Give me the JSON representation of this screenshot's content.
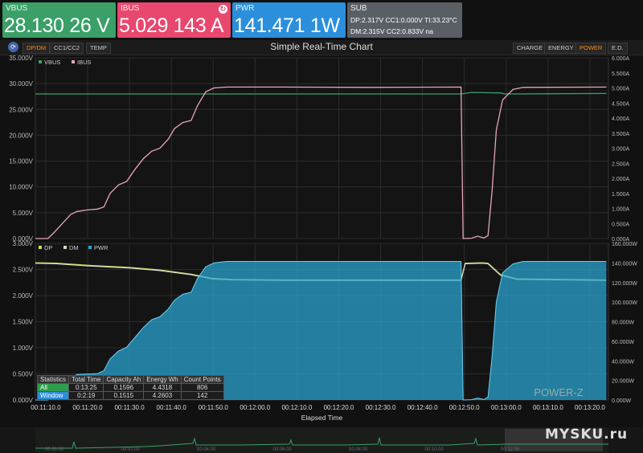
{
  "cards": {
    "vbus": {
      "label": "VBUS",
      "value": "28.130 26 V",
      "color": "#3aa068"
    },
    "ibus": {
      "label": "IBUS",
      "value": "5.029 143 A",
      "color": "#e8476e"
    },
    "pwr": {
      "label": "PWR",
      "value": "141.471 1W",
      "color": "#2b8fdb"
    },
    "sub": {
      "label": "SUB",
      "line1": "DP:2.317V   CC1:0.000V   TI:33.23°C",
      "line2": "DM:2.315V   CC2:0.833V  na"
    }
  },
  "toolbar": {
    "left_tabs": [
      "DP/DM",
      "CC1/CC2",
      "TEMP"
    ],
    "right_tabs": [
      "CHARGE",
      "ENERGY",
      "POWER",
      "E.D."
    ],
    "active_left": "DP/DM",
    "active_right": "POWER",
    "title": "Simple Real-Time Chart",
    "icon": "power-z-logo-icon"
  },
  "chart_data": [
    {
      "type": "line",
      "x_ticks": [
        "00:11:10.0",
        "00:11:20.0",
        "00:11:30.0",
        "00:11:40.0",
        "00:11:50.0",
        "00:12:00.0",
        "00:12:10.0",
        "00:12:20.0",
        "00:12:30.0",
        "00:12:40.0",
        "00:12:50.0",
        "00:13:00.0",
        "00:13:10.0",
        "00:13:20.0"
      ],
      "xlabel": "Elapsed Time",
      "ylim_left": [
        0,
        35
      ],
      "y_ticks_left": [
        "0.000V",
        "5.000V",
        "10.000V",
        "15.000V",
        "20.000V",
        "25.000V",
        "30.000V",
        "35.000V"
      ],
      "ylim_right": [
        0,
        6
      ],
      "y_ticks_right": [
        "0.000A",
        "0.500A",
        "1.000A",
        "1.500A",
        "2.000A",
        "2.500A",
        "3.000A",
        "3.500A",
        "4.000A",
        "4.500A",
        "5.000A",
        "5.500A",
        "6.000A"
      ],
      "legend": [
        "VBUS",
        "IBUS"
      ],
      "series": [
        {
          "name": "VBUS",
          "axis": "left",
          "color": "#3aa068",
          "points": [
            [
              0,
              28
            ],
            [
              100,
              28
            ],
            [
              205,
              28
            ],
            [
              210,
              28.3
            ],
            [
              224,
              28.2
            ],
            [
              226,
              28
            ],
            [
              250,
              28.05
            ],
            [
              275,
              28.1
            ]
          ]
        },
        {
          "name": "IBUS",
          "axis": "right",
          "color": "#e8a6b6",
          "points": [
            [
              0,
              0
            ],
            [
              6,
              0
            ],
            [
              9,
              0.2
            ],
            [
              13,
              0.5
            ],
            [
              17,
              0.8
            ],
            [
              20,
              0.9
            ],
            [
              25,
              0.95
            ],
            [
              30,
              0.98
            ],
            [
              33,
              1.05
            ],
            [
              36,
              1.5
            ],
            [
              40,
              1.78
            ],
            [
              44,
              1.9
            ],
            [
              48,
              2.3
            ],
            [
              52,
              2.65
            ],
            [
              56,
              2.9
            ],
            [
              60,
              3.0
            ],
            [
              64,
              3.3
            ],
            [
              67,
              3.65
            ],
            [
              71,
              3.85
            ],
            [
              75,
              3.92
            ],
            [
              78,
              4.4
            ],
            [
              82,
              4.87
            ],
            [
              86,
              5.0
            ],
            [
              92,
              5.03
            ],
            [
              120,
              5.03
            ],
            [
              160,
              5.02
            ],
            [
              205,
              5.03
            ],
            [
              206,
              0.0
            ],
            [
              210,
              0.01
            ],
            [
              213,
              0.08
            ],
            [
              216,
              0.02
            ],
            [
              218,
              0.1
            ],
            [
              220,
              1.6
            ],
            [
              222,
              3.6
            ],
            [
              225,
              4.6
            ],
            [
              230,
              4.95
            ],
            [
              235,
              5.02
            ],
            [
              275,
              5.03
            ]
          ]
        }
      ]
    },
    {
      "type": "area",
      "x_ticks": [
        "00:11:10.0",
        "00:11:20.0",
        "00:11:30.0",
        "00:11:40.0",
        "00:11:50.0",
        "00:12:00.0",
        "00:12:10.0",
        "00:12:20.0",
        "00:12:30.0",
        "00:12:40.0",
        "00:12:50.0",
        "00:13:00.0",
        "00:13:10.0",
        "00:13:20.0"
      ],
      "xlabel": "Elapsed Time",
      "ylim_left": [
        0,
        3
      ],
      "y_ticks_left": [
        "0.000V",
        "0.500V",
        "1.000V",
        "1.500V",
        "2.000V",
        "2.500V",
        "3.000V"
      ],
      "ylim_right": [
        0,
        160
      ],
      "y_ticks_right": [
        "0.000W",
        "20.000W",
        "40.000W",
        "60.000W",
        "80.000W",
        "100.000W",
        "120.000W",
        "140.000W",
        "160.000W"
      ],
      "legend": [
        "DP",
        "DM",
        "PWR"
      ],
      "series": [
        {
          "name": "DP",
          "axis": "left",
          "color": "#c8e04a",
          "points": [
            [
              0,
              2.63
            ],
            [
              10,
              2.62
            ],
            [
              25,
              2.58
            ],
            [
              45,
              2.54
            ],
            [
              60,
              2.49
            ],
            [
              75,
              2.41
            ],
            [
              85,
              2.33
            ],
            [
              95,
              2.31
            ],
            [
              120,
              2.3
            ],
            [
              205,
              2.3
            ],
            [
              207,
              2.62
            ],
            [
              215,
              2.63
            ],
            [
              218,
              2.62
            ],
            [
              224,
              2.4
            ],
            [
              232,
              2.32
            ],
            [
              275,
              2.3
            ]
          ]
        },
        {
          "name": "DM",
          "axis": "left",
          "color": "#d8d8c8",
          "points": [
            [
              0,
              2.62
            ],
            [
              10,
              2.61
            ],
            [
              25,
              2.57
            ],
            [
              45,
              2.53
            ],
            [
              60,
              2.48
            ],
            [
              75,
              2.4
            ],
            [
              85,
              2.32
            ],
            [
              95,
              2.3
            ],
            [
              120,
              2.29
            ],
            [
              205,
              2.29
            ],
            [
              207,
              2.61
            ],
            [
              215,
              2.62
            ],
            [
              218,
              2.61
            ],
            [
              224,
              2.39
            ],
            [
              232,
              2.31
            ],
            [
              275,
              2.29
            ]
          ]
        },
        {
          "name": "PWR",
          "axis": "right",
          "color": "#29a8d6",
          "points": [
            [
              0,
              0
            ],
            [
              6,
              0
            ],
            [
              9,
              6
            ],
            [
              13,
              14
            ],
            [
              17,
              22
            ],
            [
              20,
              26
            ],
            [
              30,
              27
            ],
            [
              33,
              30
            ],
            [
              36,
              42
            ],
            [
              40,
              50
            ],
            [
              44,
              54
            ],
            [
              48,
              64
            ],
            [
              52,
              74
            ],
            [
              56,
              82
            ],
            [
              60,
              85
            ],
            [
              64,
              93
            ],
            [
              67,
              102
            ],
            [
              71,
              108
            ],
            [
              75,
              110
            ],
            [
              78,
              124
            ],
            [
              82,
              136
            ],
            [
              86,
              140
            ],
            [
              92,
              141.5
            ],
            [
              205,
              141.5
            ],
            [
              206,
              0
            ],
            [
              210,
              0.3
            ],
            [
              213,
              2
            ],
            [
              216,
              0.5
            ],
            [
              218,
              3
            ],
            [
              220,
              45
            ],
            [
              222,
              100
            ],
            [
              225,
              130
            ],
            [
              230,
              139
            ],
            [
              235,
              141.5
            ],
            [
              275,
              141.5
            ]
          ]
        }
      ]
    }
  ],
  "statistics": {
    "headers": [
      "Statistics",
      "Total Time",
      "Capacity Ah",
      "Energy Wh",
      "Count Points"
    ],
    "rows": [
      {
        "label": "All",
        "values": [
          "0:13:25",
          "0.1596",
          "4.4318",
          "806"
        ]
      },
      {
        "label": "Window",
        "values": [
          "0:2:19",
          "0.1515",
          "4.2603",
          "142"
        ]
      }
    ]
  },
  "minimap": {
    "ticks": [
      "00:00:00",
      "00:02:00",
      "00:04:00",
      "00:06:00",
      "00:08:00",
      "00:10:00",
      "00:12:00"
    ]
  },
  "brand": "POWER-Z",
  "watermark": "MYSKU.ru"
}
